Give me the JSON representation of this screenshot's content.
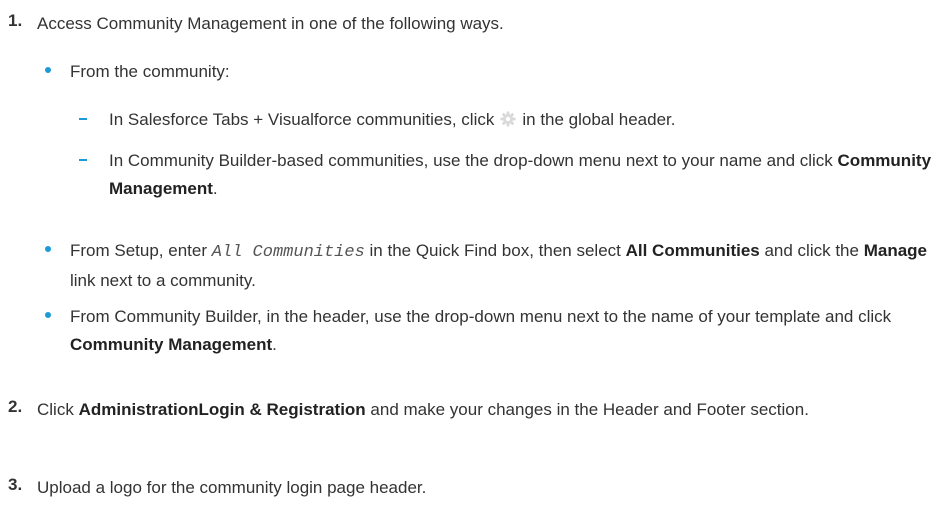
{
  "colors": {
    "bullet": "#1c9ad6",
    "text": "#333333",
    "gear_icon": "#d9d9d9"
  },
  "steps": [
    {
      "number": "1.",
      "text": "Access Community Management in one of the following ways.",
      "bullets": [
        {
          "text": "From the community:",
          "subitems": [
            {
              "before": "In Salesforce Tabs + Visualforce communities, click",
              "icon": "gear-icon",
              "after": "in the global header."
            },
            {
              "before": "In Community Builder-based communities, use the drop-down menu next to your name and click",
              "bold": "Community Management",
              "after": "."
            }
          ]
        },
        {
          "before": "From Setup, enter",
          "code": "All Communities",
          "middle": "in the Quick Find box, then select",
          "bold1": "All Communities",
          "middle2": "and click the",
          "bold2": "Manage",
          "after": "link next to a community."
        },
        {
          "before": "From Community Builder, in the header, use the drop-down menu next to the name of your template and click",
          "bold": "Community Management",
          "after": "."
        }
      ]
    },
    {
      "number": "2.",
      "before": "Click",
      "bold": "AdministrationLogin & Registration",
      "after": "and make your changes in the Header and Footer section."
    },
    {
      "number": "3.",
      "text": "Upload a logo for the community login page header."
    }
  ]
}
